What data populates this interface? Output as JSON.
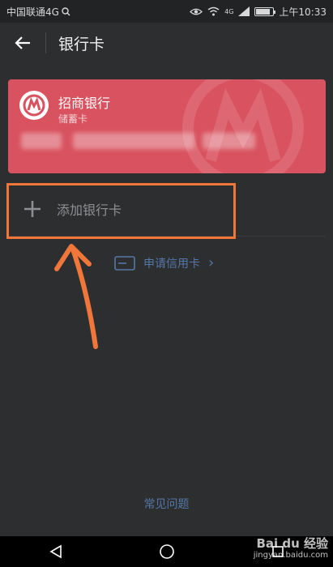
{
  "status_bar": {
    "carrier": "中国联通4G",
    "time": "上午10:33",
    "network_label": "4G",
    "battery_level": 0.85
  },
  "app_bar": {
    "title": "银行卡"
  },
  "card": {
    "bank_name": "招商银行",
    "card_type": "储蓄卡",
    "color": "#d8525f"
  },
  "add_card": {
    "label": "添加银行卡"
  },
  "apply_credit": {
    "label": "申请信用卡",
    "chevron": "›"
  },
  "faq": {
    "label": "常见问题"
  },
  "watermark": {
    "brand": "Bai du 经验",
    "url": "jingyan.baidu.com"
  },
  "colors": {
    "accent_link": "#5577a8",
    "highlight": "#f0763a",
    "background": "#2d2e30"
  }
}
